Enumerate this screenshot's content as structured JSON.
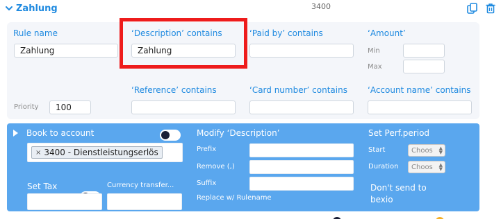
{
  "header": {
    "rule_title": "Zahlung",
    "account_number": "3400"
  },
  "rule_panel": {
    "rule_name": {
      "label": "Rule name",
      "value": "Zahlung"
    },
    "description": {
      "label": "‘Description’ contains",
      "value": "Zahlung"
    },
    "paid_by": {
      "label": "‘Paid by’ contains",
      "value": ""
    },
    "amount": {
      "label": "‘Amount’",
      "min_label": "Min",
      "max_label": "Max",
      "min_value": "",
      "max_value": ""
    },
    "priority": {
      "label": "Priority",
      "value": "100"
    },
    "reference": {
      "label": "‘Reference’ contains",
      "value": ""
    },
    "card_number": {
      "label": "‘Card number’ contains",
      "value": ""
    },
    "account_name": {
      "label": "‘Account name’ contains",
      "value": ""
    }
  },
  "action_panel": {
    "book_to_account": {
      "label": "Book to account",
      "toggle_on": false,
      "selected_tag": "3400 - Dienstleistungserlös",
      "remove_symbol": "×"
    },
    "set_tax": {
      "label": "Set Tax",
      "toggle_on": false
    },
    "currency_transfer": {
      "label": "Currency transfer..."
    },
    "modify_description": {
      "label": "Modify ‘Description’",
      "prefix_label": "Prefix",
      "remove_label": "Remove (,)",
      "suffix_label": "Suffix",
      "replace_label": "Replace w/ Rulename",
      "replace_toggle_on": false
    },
    "perf_period": {
      "label": "Set Perf.period",
      "start_label": "Start",
      "duration_label": "Duration",
      "start_value": "Choos",
      "duration_value": "Choos"
    },
    "dont_send": {
      "label_line1": "Don't send to",
      "label_line2": "bexio",
      "toggle_on": true
    }
  },
  "colors": {
    "accent": "#1f8ae0",
    "action_panel": "#5aa7ee",
    "highlight": "#ee1c1c",
    "toggle_on_knob": "#f6b026"
  },
  "icons": [
    "chevron-down-icon",
    "duplicate-icon",
    "trash-icon",
    "expand-triangle-icon"
  ]
}
